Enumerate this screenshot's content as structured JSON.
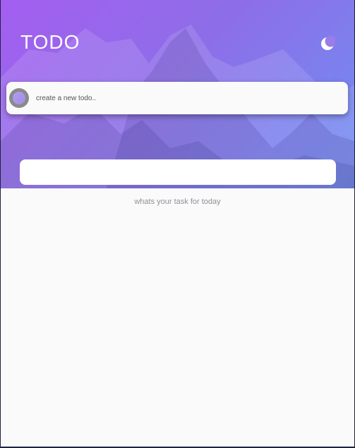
{
  "app": {
    "title": "TODO"
  },
  "header": {
    "theme_toggle_icon": "moon-icon"
  },
  "new_todo": {
    "placeholder": "create a new todo..",
    "value": ""
  },
  "list": {
    "empty_message": "whats your task for today",
    "items": []
  },
  "colors": {
    "gradient_start": "#a45ef0",
    "gradient_end": "#6f8ff2",
    "surface": "#fafafa",
    "muted_text": "#8f8f99"
  }
}
